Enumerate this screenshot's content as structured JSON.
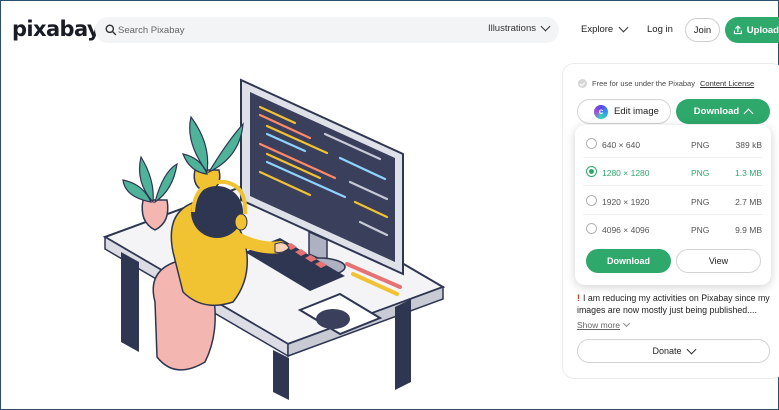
{
  "header": {
    "logo": "pixabay",
    "search_placeholder": "Search Pixabay",
    "filter_label": "Illustrations",
    "explore_label": "Explore",
    "login_label": "Log in",
    "join_label": "Join",
    "upload_label": "Upload"
  },
  "panel": {
    "license_text": "Free for use under the Pixabay",
    "license_link": "Content License",
    "edit_label": "Edit image",
    "download_label": "Download",
    "options": [
      {
        "resolution": "640 × 640",
        "format": "PNG",
        "size": "389 kB",
        "selected": false
      },
      {
        "resolution": "1280 × 1280",
        "format": "PNG",
        "size": "1.3 MB",
        "selected": true
      },
      {
        "resolution": "1920 × 1920",
        "format": "PNG",
        "size": "2.7 MB",
        "selected": false
      },
      {
        "resolution": "4096 × 4096",
        "format": "PNG",
        "size": "9.9 MB",
        "selected": false
      }
    ],
    "dd_download_label": "Download",
    "dd_view_label": "View"
  },
  "author": {
    "bio_mark": "!",
    "bio_text": "I am reducing my activities on Pixabay since my images are now mostly just being published....",
    "show_more": "Show more",
    "donate_label": "Donate"
  },
  "colors": {
    "brand_green": "#2ea86b",
    "frame_border": "#2c4f6e"
  }
}
